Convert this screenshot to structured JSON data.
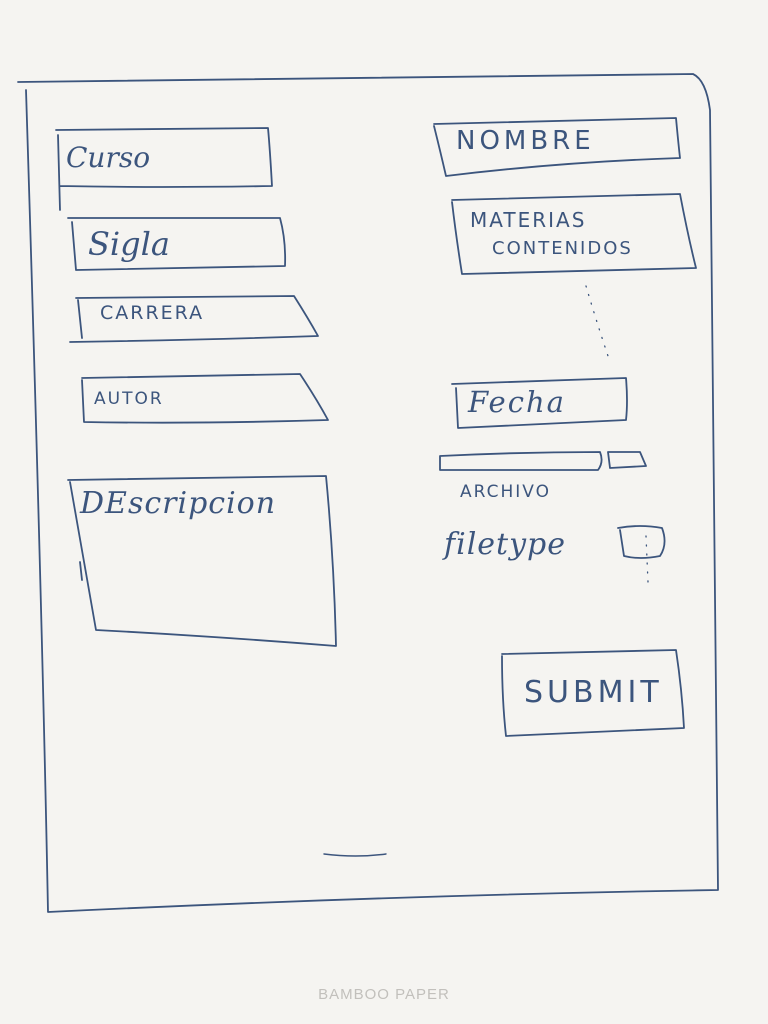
{
  "form": {
    "left": {
      "curso": "Curso",
      "sigla": "Sigla",
      "carrera": "CARRERA",
      "autor": "AUTOR",
      "descripcion": "DEscripcion"
    },
    "right": {
      "nombre": "NOMBRE",
      "materias_line1": "MATERIAS",
      "materias_line2": "CONTENIDOS",
      "fecha": "Fecha",
      "archivo": "ARCHIVO",
      "filetype": "filetype",
      "submit": "SUBMIT"
    }
  },
  "footer": {
    "brand": "BAMBOO PAPER"
  },
  "colors": {
    "ink": "#3c557d",
    "paper": "#f5f4f1",
    "brand": "#c2c0bc"
  }
}
